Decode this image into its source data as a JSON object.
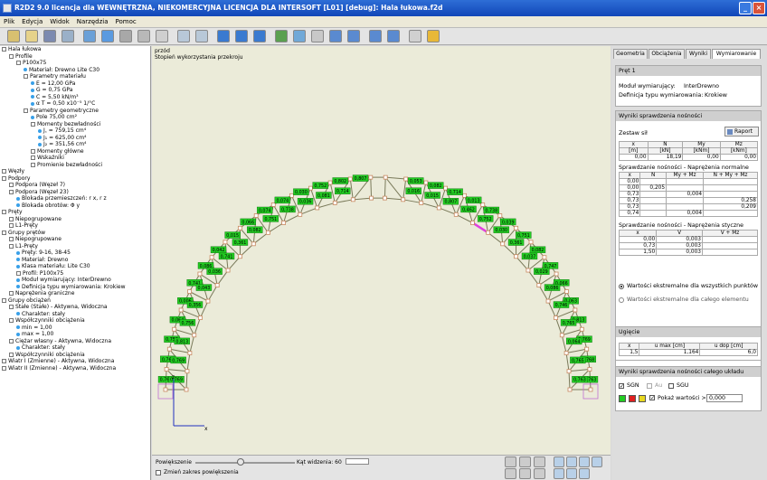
{
  "window": {
    "title": "R2D2 9.0 licencja dla WEWNĘTRZNA, NIEKOMERCYJNA LICENCJA DLA INTERSOFT [L01] [debug]: Hala łukowa.f2d"
  },
  "menu": [
    "Plik",
    "Edycja",
    "Widok",
    "Narzędzia",
    "Pomoc"
  ],
  "tree": [
    {
      "depth": 0,
      "icon": "box",
      "text": "Hala łukowa"
    },
    {
      "depth": 1,
      "icon": "box",
      "text": "Profile"
    },
    {
      "depth": 2,
      "icon": "box",
      "text": "P100x75"
    },
    {
      "depth": 3,
      "icon": "dot",
      "text": "Materiał: Drewno Lite C30"
    },
    {
      "depth": 3,
      "icon": "box",
      "text": "Parametry materiału"
    },
    {
      "depth": 4,
      "icon": "dot",
      "text": "E = 12,00 GPa"
    },
    {
      "depth": 4,
      "icon": "dot",
      "text": "G = 0,75 GPa"
    },
    {
      "depth": 4,
      "icon": "dot",
      "text": "C = 5,50 kN/m³"
    },
    {
      "depth": 4,
      "icon": "dot",
      "text": "α T = 0,50 x10⁻⁵ 1/°C"
    },
    {
      "depth": 3,
      "icon": "box",
      "text": "Parametry geometryczne"
    },
    {
      "depth": 4,
      "icon": "dot",
      "text": "Pole 75,00 cm²"
    },
    {
      "depth": 4,
      "icon": "box",
      "text": "Momenty bezwładności"
    },
    {
      "depth": 5,
      "icon": "dot",
      "text": "J꜀ = 759,15 cm⁴"
    },
    {
      "depth": 5,
      "icon": "dot",
      "text": "J₁ = 625,00 cm⁴"
    },
    {
      "depth": 5,
      "icon": "dot",
      "text": "J₂ = 351,56 cm⁴"
    },
    {
      "depth": 4,
      "icon": "box",
      "text": "Momenty główne"
    },
    {
      "depth": 4,
      "icon": "box",
      "text": "Wskaźniki"
    },
    {
      "depth": 4,
      "icon": "box",
      "text": "Promienie bezwładności"
    },
    {
      "depth": 0,
      "icon": "box",
      "text": "Węzły"
    },
    {
      "depth": 0,
      "icon": "box",
      "text": "Podpory"
    },
    {
      "depth": 1,
      "icon": "box",
      "text": "Podpora (Węzeł 7)"
    },
    {
      "depth": 1,
      "icon": "box",
      "text": "Podpora (Węzeł 23)"
    },
    {
      "depth": 2,
      "icon": "dot",
      "text": "Blokada przemieszczeń: r x, r z"
    },
    {
      "depth": 2,
      "icon": "dot",
      "text": "Blokada obrotów: Φ y"
    },
    {
      "depth": 0,
      "icon": "box",
      "text": "Pręty"
    },
    {
      "depth": 1,
      "icon": "box",
      "text": "Niepogrupowane"
    },
    {
      "depth": 1,
      "icon": "box",
      "text": "L1-Pręty"
    },
    {
      "depth": 0,
      "icon": "box",
      "text": "Grupy prętów"
    },
    {
      "depth": 1,
      "icon": "box",
      "text": "Niepogrupowane"
    },
    {
      "depth": 1,
      "icon": "box",
      "text": "L1-Pręty"
    },
    {
      "depth": 2,
      "icon": "dot",
      "text": "Pręty: 9-16, 38-45"
    },
    {
      "depth": 2,
      "icon": "dot",
      "text": "Materiał: Drewno"
    },
    {
      "depth": 2,
      "icon": "dot",
      "text": "Klasa materiału: Lite C30"
    },
    {
      "depth": 2,
      "icon": "box",
      "text": "Profil: P100x75"
    },
    {
      "depth": 2,
      "icon": "dot",
      "text": "Moduł wymiarujący: InterDrewno"
    },
    {
      "depth": 2,
      "icon": "dot",
      "text": "Definicja typu wymiarowania: Krokiew"
    },
    {
      "depth": 1,
      "icon": "box",
      "text": "Naprężenia graniczne"
    },
    {
      "depth": 0,
      "icon": "box",
      "text": "Grupy obciążeń"
    },
    {
      "depth": 1,
      "icon": "box",
      "text": "Stałe (Stałe) - Aktywna, Widoczna"
    },
    {
      "depth": 2,
      "icon": "dot",
      "text": "Charakter: stały"
    },
    {
      "depth": 1,
      "icon": "box",
      "text": "Współczynniki obciążenia"
    },
    {
      "depth": 2,
      "icon": "dot",
      "text": "min = 1,00"
    },
    {
      "depth": 2,
      "icon": "dot",
      "text": "max = 1,00"
    },
    {
      "depth": 1,
      "icon": "box",
      "text": "Ciężar własny - Aktywna, Widoczna"
    },
    {
      "depth": 2,
      "icon": "dot",
      "text": "Charakter: stały"
    },
    {
      "depth": 1,
      "icon": "box",
      "text": "Współczynniki obciążenia"
    },
    {
      "depth": 0,
      "icon": "box",
      "text": "Wiatr I (Zmienne) - Aktywna, Widoczna"
    },
    {
      "depth": 0,
      "icon": "box",
      "text": "Wiatr II (Zmienne) - Aktywna, Widoczna"
    }
  ],
  "canvas": {
    "view": "przód",
    "subtitle": "Stopień wykorzystania przekroju",
    "axis_z": "z",
    "axis_x": "x",
    "left_labels": [
      "0,763",
      "0,769",
      "0,763",
      "0,769",
      "0,756",
      "0,813",
      "0,064",
      "0,756",
      "0,006",
      "0,356",
      "0,741",
      "0,043",
      "0,086",
      "0,036",
      "0,042",
      "0,741",
      "0,015",
      "0,361",
      "0,066",
      "0,082",
      "0,074",
      "0,751",
      "0,074",
      "0,738",
      "0,030",
      "0,036",
      "0,752",
      "0,081",
      "0,802",
      "0,714",
      "0,807"
    ],
    "right_labels": [
      "0,763",
      "0,763",
      "0,768",
      "0,765",
      "0,769",
      "0,064",
      "0,813",
      "0,765",
      "0,063",
      "0,746",
      "0,066",
      "0,086",
      "0,747",
      "0,029",
      "0,082",
      "0,037",
      "0,751",
      "0,361",
      "0,039",
      "0,030",
      "0,738",
      "0,752",
      "0,013",
      "0,462",
      "0,714",
      "0,807",
      "0,082",
      "0,015",
      "0,053",
      "0,016"
    ]
  },
  "bottom": {
    "zoom_label": "Powiększenie",
    "angle_label": "Kąt widzenia: 60",
    "change_zoom_label": "Zmień zakres powiększenia"
  },
  "tabs": [
    "Geometria",
    "Obciążenia",
    "Wyniki",
    "Wymiarowanie"
  ],
  "member": {
    "header": "Pręt 1",
    "module_label": "Moduł wymiarujący:",
    "module_value": "InterDrewno",
    "def_label": "Definicja typu wymiarowania:",
    "def_value": "Krokiew"
  },
  "results": {
    "header": "Wyniki sprawdzenia nośności",
    "forces_label": "Zestaw sił",
    "report_button": "Raport",
    "forces_head1": [
      "x",
      "N",
      "My",
      "Mz"
    ],
    "forces_head2": [
      "[m]",
      "[kN]",
      "[kNm]",
      "[kNm]"
    ],
    "forces_row": [
      "0,00",
      "18,19",
      "0,00",
      "0,00"
    ],
    "normal_title": "Sprawdzanie nośności - Naprężenia normalne",
    "normal_head": [
      "x",
      "N",
      "My + Mz",
      "N + My + Mz"
    ],
    "normal_rows": [
      [
        "0,00",
        "",
        "",
        ""
      ],
      [
        "0,00",
        "0,205",
        "",
        ""
      ],
      [
        "0,73",
        "",
        "0,004",
        ""
      ],
      [
        "0,73",
        "",
        "",
        "0,258"
      ],
      [
        "0,73",
        "",
        "",
        "0,209"
      ],
      [
        "0,74",
        "",
        "0,004",
        ""
      ]
    ],
    "shear_title": "Sprawdzanie nośności - Naprężenia styczne",
    "shear_head": [
      "x",
      "V",
      "V + Mz"
    ],
    "shear_rows": [
      [
        "0,00",
        "0,003",
        ""
      ],
      [
        "0,73",
        "0,003",
        ""
      ],
      [
        "1,50",
        "0,003",
        ""
      ]
    ],
    "radio1": "Wartości ekstremalne dla wszystkich punktów",
    "radio2": "Wartości ekstremalne dla całego elementu"
  },
  "deflection": {
    "header": "Ugięcie",
    "head": [
      "x",
      "u max [cm]",
      "u dop [cm]"
    ],
    "row": [
      "1,5",
      "1,164",
      "6,0"
    ]
  },
  "system": {
    "header": "Wyniki sprawdzenia nośności całego układu",
    "cb1": "SGN",
    "cb2": "Au",
    "cb3": "SGU",
    "show_label": "Pokaż wartości >",
    "show_value": "0,000"
  },
  "colors": {
    "accent": "#2e6ed6",
    "label_fill": "#22cc22",
    "node": "#c88860",
    "member": "#7a7a5a",
    "highlight": "#e040e0"
  }
}
